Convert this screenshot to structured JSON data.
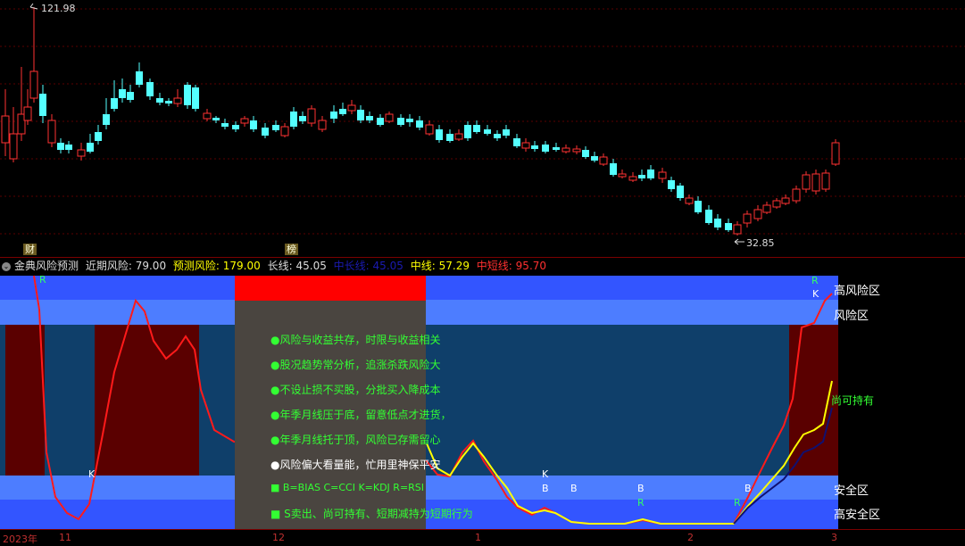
{
  "price_chart": {
    "high_label": "121.98",
    "low_label": "32.85",
    "badge_cai": "财",
    "badge_bang": "榜"
  },
  "indicator": {
    "name": "金典风险预测",
    "near_label": "近期风险:",
    "near_value": "79.00",
    "forecast_label": "预测风险:",
    "forecast_value": "179.00",
    "long_label": "长线:",
    "long_value": "45.05",
    "midlong_label": "中长线:",
    "midlong_value": "45.05",
    "mid_label": "中线:",
    "mid_value": "57.29",
    "midshort_label": "中短线:",
    "midshort_value": "95.70"
  },
  "zones": {
    "high_risk": "高风险区",
    "risk": "风险区",
    "hold": "尚可持有",
    "safe": "安全区",
    "high_safe": "高安全区"
  },
  "tips": [
    "●风险与收益共存，时限与收益相关",
    "●股况趋势常分析，追涨杀跌风险大",
    "●不设止损不买股，分批买入降成本",
    "●年季月线压于底，留意低点才进货，",
    "●年季月线托于顶，风险已存需留心",
    "●风险偏大看量能，忙用里神保平安",
    "■ B=BIAS C=CCI K=KDJ R=RSI",
    "■ S卖出、尚可持有、短期减持为短期行为"
  ],
  "markers": [
    "R",
    "K",
    "R",
    "K",
    "K",
    "B",
    "B",
    "B",
    "B",
    "R",
    "R"
  ],
  "date_axis": [
    "2023年",
    "11",
    "12",
    "1",
    "2",
    "3"
  ],
  "colors": {
    "up": "#ff3232",
    "down": "#54ffff",
    "zone_high": "#3355ff",
    "zone_risk": "#4d7dff",
    "zone_mid": "#0f3f6a",
    "zone_dark_red": "#5a0000",
    "tip_bg": "#4a4540",
    "line_red": "#ff1a1a",
    "line_yellow": "#ffff00",
    "line_navy": "#101070"
  }
}
